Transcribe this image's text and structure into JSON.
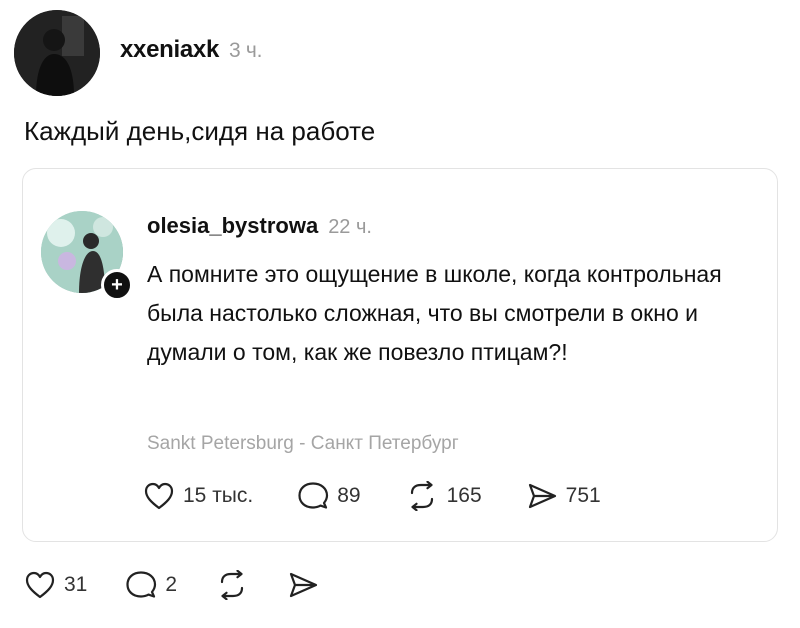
{
  "post": {
    "author": "xxeniaxk",
    "time": "3 ч.",
    "text": "Каждый день,сидя на работе",
    "actions": {
      "likes": "31",
      "comments": "2"
    }
  },
  "quote": {
    "author": "olesia_bystrowa",
    "time": "22 ч.",
    "text": "А помните это ощущение в школе, когда контрольная была настолько сложная, что вы смотрели в окно и думали о том, как же повезло птицам?!",
    "location": "Sankt Petersburg - Санкт Петербург",
    "actions": {
      "likes": "15 тыс.",
      "comments": "89",
      "reposts": "165",
      "shares": "751"
    }
  }
}
